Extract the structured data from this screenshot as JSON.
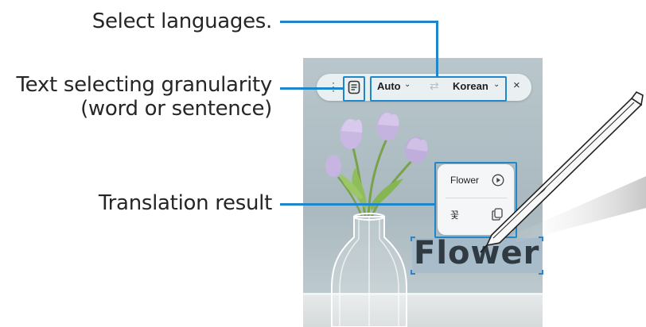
{
  "callouts": {
    "select_languages": "Select languages.",
    "granularity_line1": "Text selecting granularity",
    "granularity_line2": "(word or sentence)",
    "translation_result": "Translation result"
  },
  "toolbar": {
    "more_glyph": "⋮",
    "doc_icon": "document-icon",
    "source_language": "Auto",
    "swap_glyph": "⇄",
    "target_language": "Korean",
    "dropdown_glyph": "⌄",
    "close_glyph": "×"
  },
  "result": {
    "source_word": "Flower",
    "translated_word": "꽃",
    "play_icon": "play-icon",
    "copy_icon": "copy-icon"
  },
  "scene": {
    "selected_text": "Flower"
  },
  "colors": {
    "accent": "#1f87c9",
    "selection": "#96b4cd"
  }
}
